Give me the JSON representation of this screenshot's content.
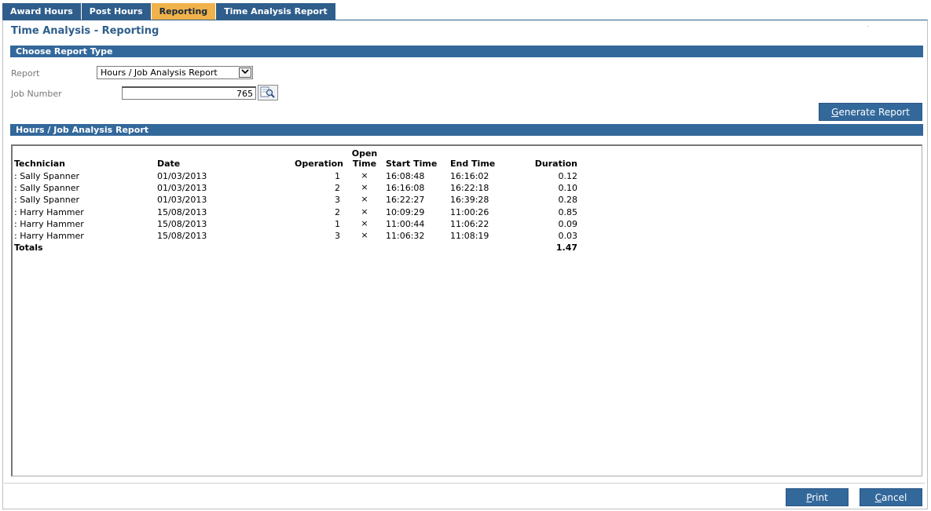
{
  "tabs": [
    {
      "label": "Award Hours",
      "active": false
    },
    {
      "label": "Post Hours",
      "active": false
    },
    {
      "label": "Reporting",
      "active": true
    },
    {
      "label": "Time Analysis Report",
      "active": false
    }
  ],
  "page_title": "Time Analysis - Reporting",
  "choose_section": {
    "title": "Choose Report Type"
  },
  "form": {
    "report_label": "Report",
    "report_selected": "Hours / Job Analysis Report",
    "job_label": "Job Number",
    "job_value": "765"
  },
  "generate_button": {
    "prefix": "G",
    "rest": "enerate Report"
  },
  "report_section": {
    "title": "Hours / Job Analysis Report"
  },
  "table": {
    "headers": {
      "technician": "Technician",
      "date": "Date",
      "operation": "Operation",
      "open_time_1": "Open",
      "open_time_2": "Time",
      "start_time": "Start Time",
      "end_time": "End Time",
      "duration": "Duration"
    },
    "rows": [
      {
        "technician": ": Sally Spanner",
        "date": "01/03/2013",
        "operation": "1",
        "open": "×",
        "start": "16:08:48",
        "end": "16:16:02",
        "duration": "0.12"
      },
      {
        "technician": ": Sally Spanner",
        "date": "01/03/2013",
        "operation": "2",
        "open": "×",
        "start": "16:16:08",
        "end": "16:22:18",
        "duration": "0.10"
      },
      {
        "technician": ": Sally Spanner",
        "date": "01/03/2013",
        "operation": "3",
        "open": "×",
        "start": "16:22:27",
        "end": "16:39:28",
        "duration": "0.28"
      },
      {
        "technician": ": Harry Hammer",
        "date": "15/08/2013",
        "operation": "2",
        "open": "×",
        "start": "10:09:29",
        "end": "11:00:26",
        "duration": "0.85"
      },
      {
        "technician": ": Harry Hammer",
        "date": "15/08/2013",
        "operation": "1",
        "open": "×",
        "start": "11:00:44",
        "end": "11:06:22",
        "duration": "0.09"
      },
      {
        "technician": ": Harry Hammer",
        "date": "15/08/2013",
        "operation": "3",
        "open": "×",
        "start": "11:06:32",
        "end": "11:08:19",
        "duration": "0.03"
      }
    ],
    "totals_label": "Totals",
    "totals_duration": "1.47"
  },
  "footer": {
    "print": {
      "prefix": "P",
      "rest": "rint"
    },
    "cancel": {
      "prefix": "C",
      "rest": "ancel"
    }
  },
  "colors": {
    "tab": "#2f5e8c",
    "tab_active": "#f0b24b",
    "section_bar": "#33689b",
    "title": "#2f5e8c"
  }
}
